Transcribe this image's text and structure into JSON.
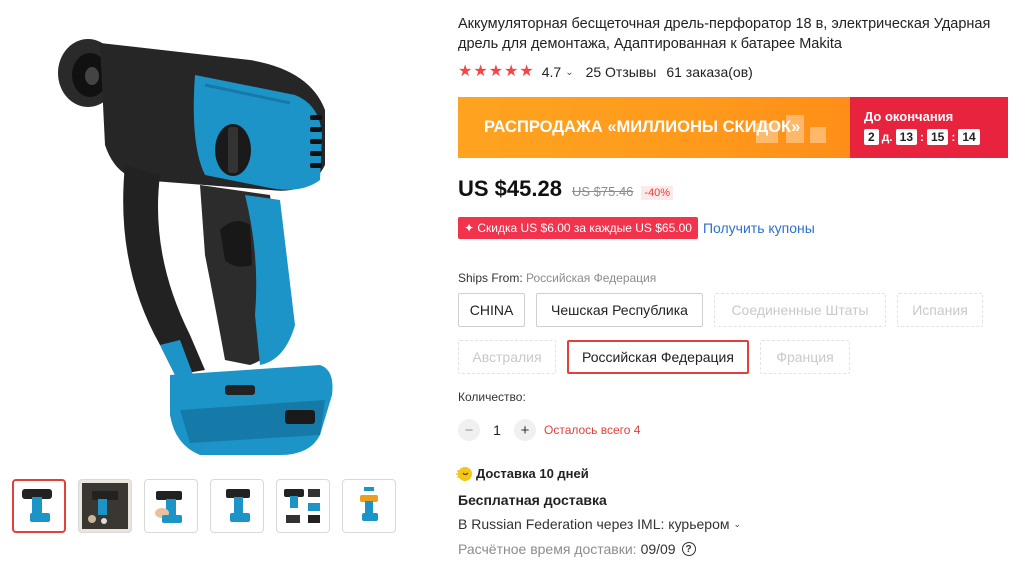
{
  "product": {
    "title": "Аккумуляторная бесщеточная дрель-перфоратор 18 в, электрическая Ударная дрель для демонтажа, Адаптированная к батарее Makita",
    "rating": "4.7",
    "reviews": "25 Отзывы",
    "orders": "61 заказа(ов)"
  },
  "banner": {
    "text": "РАСПРОДАЖА «МИЛЛИОНЫ СКИДОК»",
    "countdown_label": "До окончания",
    "days": "2",
    "days_unit": "д.",
    "hours": "13",
    "minutes": "15",
    "seconds": "14"
  },
  "price": {
    "current": "US $45.28",
    "old": "US $75.46",
    "discount": "-40%"
  },
  "coupon": {
    "badge": "✦ Скидка US $6.00 за каждые US $65.00",
    "link": "Получить купоны"
  },
  "shipping": {
    "ships_from_label": "Ships From:",
    "ships_from_value": "Российская Федерация",
    "options": [
      {
        "label": "CHINA",
        "state": "available"
      },
      {
        "label": "Чешская Республика",
        "state": "available"
      },
      {
        "label": "Соединенные Штаты",
        "state": "disabled"
      },
      {
        "label": "Испания",
        "state": "disabled"
      },
      {
        "label": "Австралия",
        "state": "disabled"
      },
      {
        "label": "Российская Федерация",
        "state": "selected"
      },
      {
        "label": "Франция",
        "state": "disabled"
      }
    ]
  },
  "quantity": {
    "label": "Количество:",
    "value": "1",
    "minus": "−",
    "plus": "+",
    "remaining": "Осталось всего 4"
  },
  "delivery": {
    "headline": "Доставка 10 дней",
    "free": "Бесплатная доставка",
    "via": "В Russian Federation через IML: курьером",
    "eta_label": "Расчётное время доставки:",
    "eta_value": "09/09",
    "help": "?"
  },
  "colors": {
    "accent_red": "#e0413a",
    "banner_orange": "#ff9a1c",
    "banner_red": "#e8233d",
    "link_blue": "#2e6fd0",
    "tool_blue": "#1fa0d0"
  }
}
